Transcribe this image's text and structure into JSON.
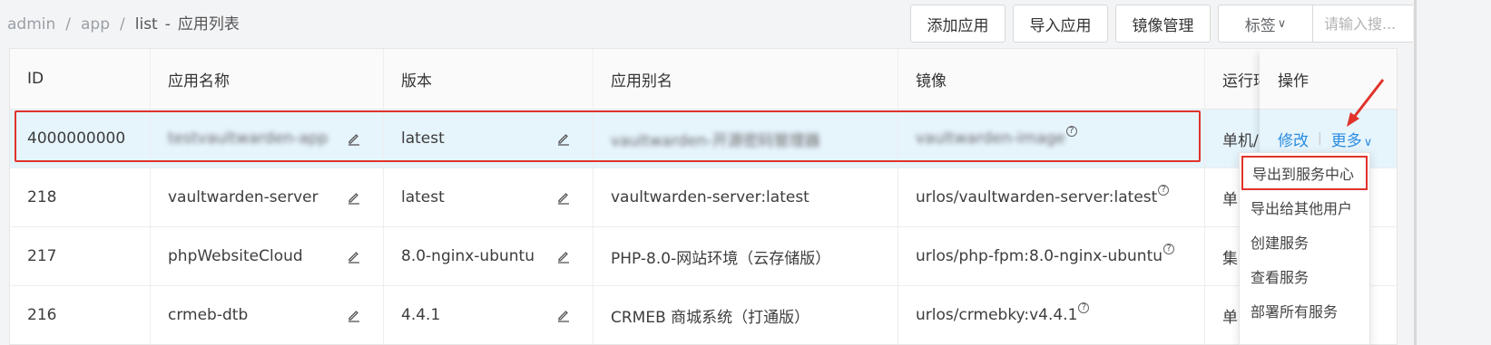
{
  "breadcrumb": {
    "items": [
      "admin",
      "app",
      "list"
    ],
    "dash": "-",
    "current": "应用列表"
  },
  "toolbar": {
    "add_label": "添加应用",
    "import_label": "导入应用",
    "mirror_label": "镜像管理",
    "tags_label": "标签",
    "tags_chevron": "∨",
    "search_placeholder": "请输入搜..."
  },
  "table": {
    "headers": {
      "id": "ID",
      "name": "应用名称",
      "version": "版本",
      "alias": "应用别名",
      "image": "镜像",
      "runtime": "运行环",
      "ops": "操作"
    },
    "rows": [
      {
        "id": "4000000000",
        "name": "testvaultwarden-app",
        "version": "latest",
        "alias": "vaultwarden-开源密码管理器",
        "image": "vaultwarden-image",
        "runtime": "单机/",
        "hint": "?"
      },
      {
        "id": "218",
        "name": "vaultwarden-server",
        "version": "latest",
        "alias": "vaultwarden-server:latest",
        "image": "urlos/vaultwarden-server:latest",
        "runtime": "单",
        "hint": "?"
      },
      {
        "id": "217",
        "name": "phpWebsiteCloud",
        "version": "8.0-nginx-ubuntu",
        "alias": "PHP-8.0-网站环境（云存储版）",
        "image": "urlos/php-fpm:8.0-nginx-ubuntu",
        "runtime": "集",
        "hint": "?"
      },
      {
        "id": "216",
        "name": "crmeb-dtb",
        "version": "4.4.1",
        "alias": "CRMEB 商城系统（打通版）",
        "image": "urlos/crmebky:v4.4.1",
        "runtime": "单",
        "hint": "?"
      }
    ]
  },
  "ops": {
    "edit_label": "修改",
    "sep": "|",
    "more_label": "更多",
    "more_chevron": "∨"
  },
  "dropdown": {
    "items": [
      "导出到服务中心",
      "导出给其他用户",
      "创建服务",
      "查看服务",
      "部署所有服务"
    ]
  },
  "colors": {
    "accent": "#2a8ce0",
    "highlight_row": "#e6f4fc",
    "annotation_red": "#e0332b"
  }
}
